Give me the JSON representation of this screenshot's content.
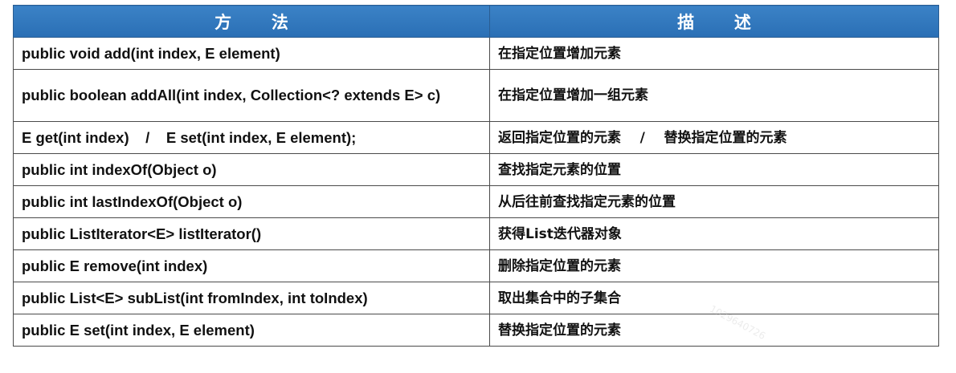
{
  "header": {
    "method": "方 法",
    "description": "描 述"
  },
  "rows": [
    {
      "method": "public void add(int index, E element)",
      "description": "在指定位置增加元素"
    },
    {
      "method": "public boolean addAll(int index, Collection<? extends E> c)",
      "description": "在指定位置增加一组元素"
    },
    {
      "method": "E get(int index)    /    E set(int index, E element);",
      "description": "返回指定位置的元素    /    替换指定位置的元素"
    },
    {
      "method": "public int indexOf(Object o)",
      "description": "查找指定元素的位置"
    },
    {
      "method": "public int lastIndexOf(Object o)",
      "description": "从后往前查找指定元素的位置"
    },
    {
      "method": "public ListIterator<E> listIterator()",
      "description": "获得List迭代器对象"
    },
    {
      "method": "public E remove(int index)",
      "description": "删除指定位置的元素"
    },
    {
      "method": "public List<E> subList(int fromIndex, int toIndex)",
      "description": "取出集合中的子集合"
    },
    {
      "method": "public E set(int index, E element)",
      "description": "替换指定位置的元素"
    }
  ],
  "watermark": "1029640726"
}
